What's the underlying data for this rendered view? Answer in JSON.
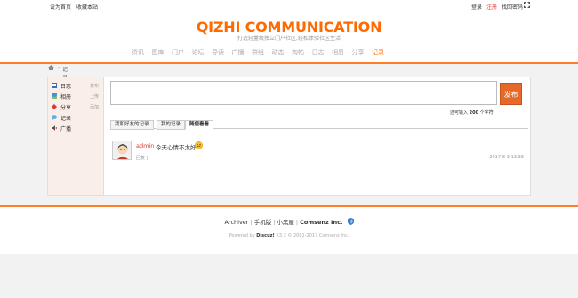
{
  "topbar": {
    "set_home": "设为首页",
    "bookmark": "收藏本站",
    "login": "登录",
    "register": "注册",
    "find_password": "找回密码"
  },
  "header": {
    "logo": "QIZHI COMMUNICATION",
    "slogan": "打造轻量级独立门户社区,轻松体验社区生活"
  },
  "nav": {
    "items": [
      "资讯",
      "图库",
      "门户",
      "论坛",
      "导读",
      "广播",
      "群组",
      "动态",
      "淘帖",
      "日志",
      "相册",
      "分享",
      "记录"
    ],
    "active_index": 12
  },
  "breadcrumb": {
    "separator": "›",
    "current": "记录"
  },
  "sidebar": {
    "items": [
      {
        "label": "日志",
        "action": "发布",
        "icon": "blog-icon"
      },
      {
        "label": "相册",
        "action": "上传",
        "icon": "album-icon"
      },
      {
        "label": "分享",
        "action": "添加",
        "icon": "share-icon"
      },
      {
        "label": "记录",
        "action": "",
        "icon": "doing-icon"
      },
      {
        "label": "广播",
        "action": "",
        "icon": "broadcast-icon"
      }
    ]
  },
  "composer": {
    "publish_label": "发布",
    "hint_prefix": "还可输入",
    "hint_count": "200",
    "hint_suffix": "个字符"
  },
  "tabs": [
    {
      "label": "我和好友的记录",
      "active": false
    },
    {
      "label": "我的记录",
      "active": false
    },
    {
      "label": "随便看看",
      "active": true
    }
  ],
  "post": {
    "username": "admin",
    "text": "今天心情不太好",
    "reply_label": "回复",
    "reply_sep": "|",
    "time": "2017-8-3 13:38"
  },
  "footer": {
    "links": [
      "Archiver",
      "手机版",
      "小黑屋"
    ],
    "company": "Comsenz Inc.",
    "powered_prefix": "Powered by",
    "powered_brand": "Discuz!",
    "powered_version": "X3.3",
    "copyright": "© 2001-2017 Comsenz Inc."
  },
  "colors": {
    "accent": "#ff6a00",
    "orange_line": "#ff7e24",
    "link_red": "#e4392b",
    "publish_button": "#e4692a"
  }
}
